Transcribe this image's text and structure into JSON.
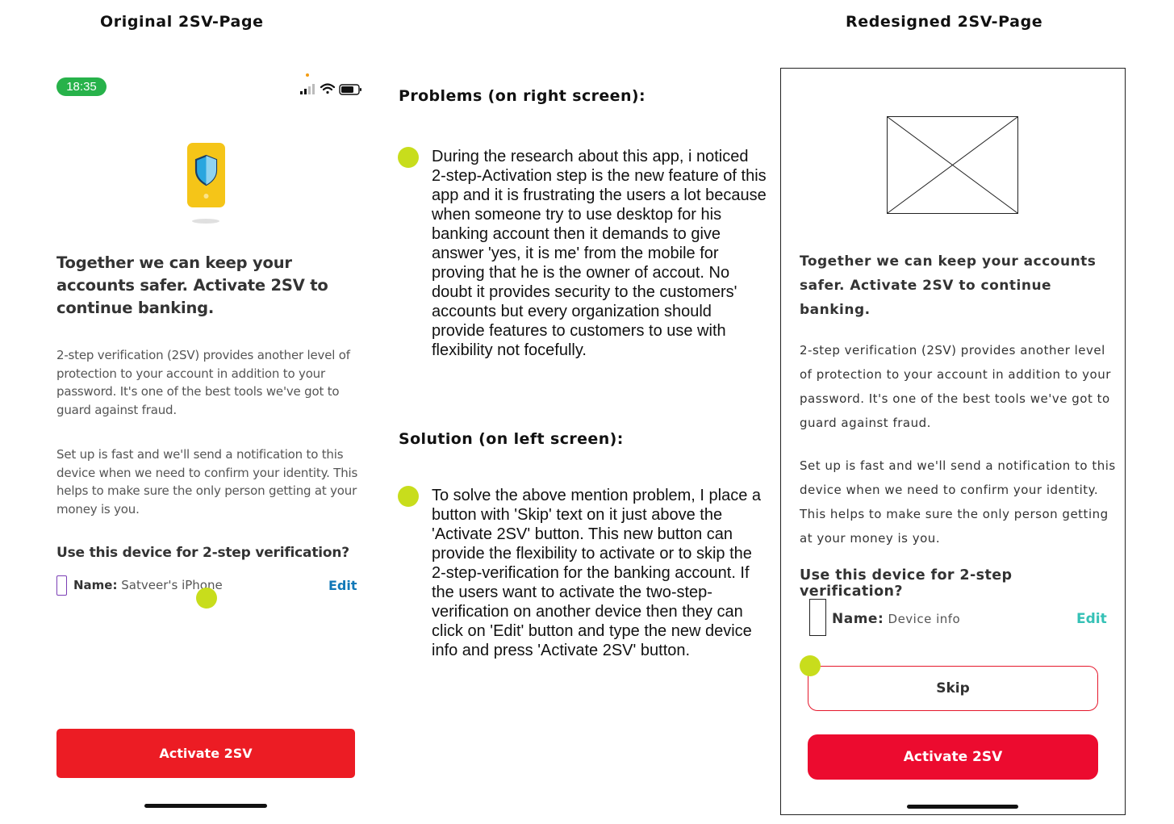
{
  "titles": {
    "original": "Original 2SV-Page",
    "redesigned": "Redesigned 2SV-Page"
  },
  "original": {
    "status_time": "18:35",
    "heading": "Together we can keep your accounts safer. Activate 2SV to continue banking.",
    "para1": "2-step verification (2SV) provides another level of protection to your account in addition to your password. It's one of the best tools we've got to guard against fraud.",
    "para2": "Set up is fast and we'll send a notification to this device when we need to confirm your identity. This helps to make sure the only person getting at your money is you.",
    "question": "Use this device for 2-step verification?",
    "device_label": "Name:",
    "device_value": "Satveer's iPhone",
    "edit_label": "Edit",
    "activate_label": "Activate 2SV",
    "icons": [
      "signal-icon",
      "wifi-icon",
      "battery-icon",
      "shield-phone-icon",
      "phone-icon"
    ]
  },
  "middle": {
    "problems_heading": "Problems (on right screen):",
    "problems_text": "During the research about this app, i noticed 2-step-Activation step is the new feature of this app and it is frustrating the users a lot because when someone try to use desktop for his banking account then it demands to give answer 'yes, it is me' from the mobile for proving that he is the owner of accout. No doubt it provides security to the customers' accounts but every organization should provide features to customers to use with flexibility not focefully.",
    "solution_heading": "Solution (on left screen):",
    "solution_text": "To solve the above mention problem, I place a button with 'Skip' text on it just above the 'Activate 2SV' button. This new button can provide the flexibility to activate or to skip the 2-step-verification for the banking account. If the users want to activate the two-step-verification on another device then they can click on 'Edit' button and type the new device info and press 'Activate 2SV' button."
  },
  "redesigned": {
    "heading": "Together we can keep your accounts safer. Activate 2SV to continue banking.",
    "para1": "2-step verification (2SV) provides another level of protection to your account in addition to your password. It's one of the best tools we've got to guard against fraud.",
    "para2": "Set up is fast and we'll send a notification to this device when we need to confirm your identity. This helps to make sure the only person getting at your money is you.",
    "question": "Use this device for 2-step verification?",
    "device_label": "Name:",
    "device_value": "Device info",
    "edit_label": "Edit",
    "skip_label": "Skip",
    "activate_label": "Activate 2SV"
  },
  "colors": {
    "primary_red": "#ec1c24",
    "redesign_red": "#ec0b2f",
    "teal_edit": "#35c1b6",
    "blue_edit": "#1178b8",
    "marker": "#c8dd1c",
    "status_green": "#27b24a"
  }
}
